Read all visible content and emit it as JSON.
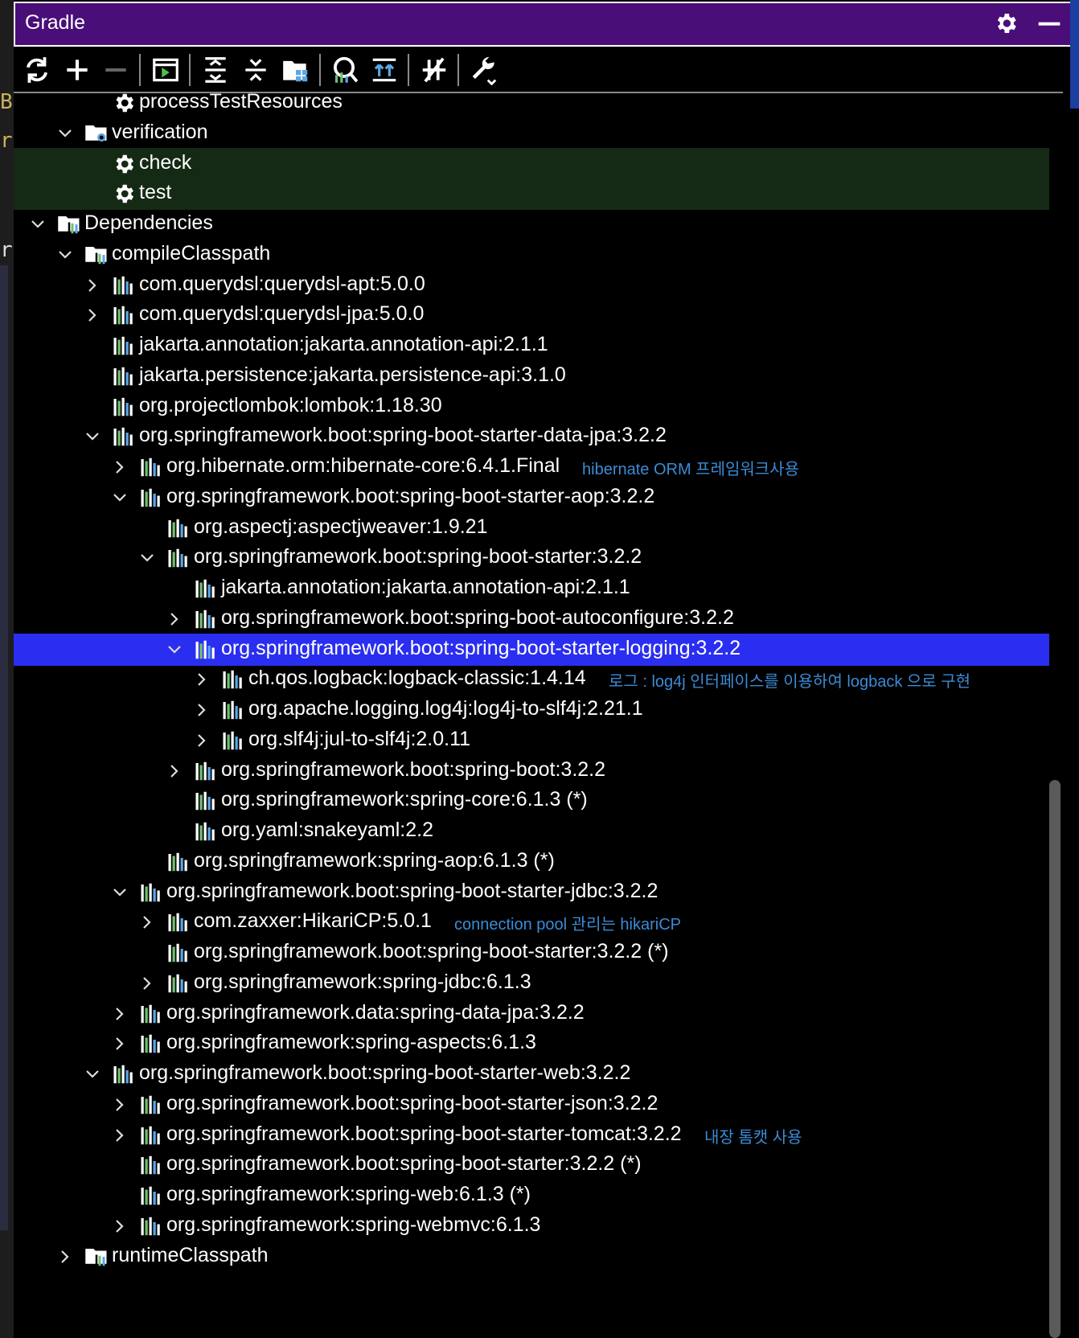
{
  "window": {
    "title": "Gradle"
  },
  "toolbar": {
    "buttons": [
      {
        "name": "reload-all-button",
        "icon": "refresh-icon"
      },
      {
        "name": "add-project-button",
        "icon": "plus-icon"
      },
      {
        "name": "remove-project-button",
        "icon": "minus-icon"
      },
      {
        "name": "execute-task-button",
        "icon": "run-terminal-icon"
      },
      {
        "name": "expand-all-button",
        "icon": "expand-all-icon"
      },
      {
        "name": "collapse-all-button",
        "icon": "collapse-all-icon"
      },
      {
        "name": "group-modules-button",
        "icon": "folder-group-icon"
      },
      {
        "name": "analyze-dependencies-button",
        "icon": "analyze-icon"
      },
      {
        "name": "show-dependencies-button",
        "icon": "dependencies-icon"
      },
      {
        "name": "toggle-offline-button",
        "icon": "offline-icon"
      },
      {
        "name": "build-tool-settings-button",
        "icon": "wrench-icon"
      }
    ]
  },
  "tree": {
    "rows": [
      {
        "label": "processTestResources",
        "icon": "gear",
        "indent": 4,
        "chevron": "none"
      },
      {
        "label": "verification",
        "icon": "folder-gear",
        "indent": 3,
        "chevron": "down"
      },
      {
        "label": "check",
        "icon": "gear",
        "indent": 4,
        "chevron": "none",
        "highlight": "green"
      },
      {
        "label": "test",
        "icon": "gear",
        "indent": 4,
        "chevron": "none",
        "highlight": "green"
      },
      {
        "label": "Dependencies",
        "icon": "folder-lib",
        "indent": 2,
        "chevron": "down"
      },
      {
        "label": "compileClasspath",
        "icon": "folder-lib",
        "indent": 3,
        "chevron": "down"
      },
      {
        "label": "com.querydsl:querydsl-apt:5.0.0",
        "icon": "lib",
        "indent": 4,
        "chevron": "right"
      },
      {
        "label": "com.querydsl:querydsl-jpa:5.0.0",
        "icon": "lib",
        "indent": 4,
        "chevron": "right"
      },
      {
        "label": "jakarta.annotation:jakarta.annotation-api:2.1.1",
        "icon": "lib",
        "indent": 4,
        "chevron": "none"
      },
      {
        "label": "jakarta.persistence:jakarta.persistence-api:3.1.0",
        "icon": "lib",
        "indent": 4,
        "chevron": "none"
      },
      {
        "label": "org.projectlombok:lombok:1.18.30",
        "icon": "lib",
        "indent": 4,
        "chevron": "none"
      },
      {
        "label": "org.springframework.boot:spring-boot-starter-data-jpa:3.2.2",
        "icon": "lib",
        "indent": 4,
        "chevron": "down"
      },
      {
        "label": "org.hibernate.orm:hibernate-core:6.4.1.Final",
        "icon": "lib",
        "indent": 5,
        "chevron": "right",
        "note": "hibernate ORM 프레임워크사용"
      },
      {
        "label": "org.springframework.boot:spring-boot-starter-aop:3.2.2",
        "icon": "lib",
        "indent": 5,
        "chevron": "down"
      },
      {
        "label": "org.aspectj:aspectjweaver:1.9.21",
        "icon": "lib",
        "indent": 6,
        "chevron": "none"
      },
      {
        "label": "org.springframework.boot:spring-boot-starter:3.2.2",
        "icon": "lib",
        "indent": 6,
        "chevron": "down"
      },
      {
        "label": "jakarta.annotation:jakarta.annotation-api:2.1.1",
        "icon": "lib",
        "indent": 7,
        "chevron": "none"
      },
      {
        "label": "org.springframework.boot:spring-boot-autoconfigure:3.2.2",
        "icon": "lib",
        "indent": 7,
        "chevron": "right"
      },
      {
        "label": "org.springframework.boot:spring-boot-starter-logging:3.2.2",
        "icon": "lib",
        "indent": 7,
        "chevron": "down",
        "selected": true
      },
      {
        "label": "ch.qos.logback:logback-classic:1.4.14",
        "icon": "lib",
        "indent": 8,
        "chevron": "right",
        "note": "로그 : log4j 인터페이스를 이용하여 logback 으로 구현"
      },
      {
        "label": "org.apache.logging.log4j:log4j-to-slf4j:2.21.1",
        "icon": "lib",
        "indent": 8,
        "chevron": "right"
      },
      {
        "label": "org.slf4j:jul-to-slf4j:2.0.11",
        "icon": "lib",
        "indent": 8,
        "chevron": "right"
      },
      {
        "label": "org.springframework.boot:spring-boot:3.2.2",
        "icon": "lib",
        "indent": 7,
        "chevron": "right"
      },
      {
        "label": "org.springframework:spring-core:6.1.3 (*)",
        "icon": "lib",
        "indent": 7,
        "chevron": "none"
      },
      {
        "label": "org.yaml:snakeyaml:2.2",
        "icon": "lib",
        "indent": 7,
        "chevron": "none"
      },
      {
        "label": "org.springframework:spring-aop:6.1.3 (*)",
        "icon": "lib",
        "indent": 6,
        "chevron": "none"
      },
      {
        "label": "org.springframework.boot:spring-boot-starter-jdbc:3.2.2",
        "icon": "lib",
        "indent": 5,
        "chevron": "down"
      },
      {
        "label": "com.zaxxer:HikariCP:5.0.1",
        "icon": "lib",
        "indent": 6,
        "chevron": "right",
        "note": "connection pool 관리는 hikariCP"
      },
      {
        "label": "org.springframework.boot:spring-boot-starter:3.2.2 (*)",
        "icon": "lib",
        "indent": 6,
        "chevron": "none"
      },
      {
        "label": "org.springframework:spring-jdbc:6.1.3",
        "icon": "lib",
        "indent": 6,
        "chevron": "right"
      },
      {
        "label": "org.springframework.data:spring-data-jpa:3.2.2",
        "icon": "lib",
        "indent": 5,
        "chevron": "right"
      },
      {
        "label": "org.springframework:spring-aspects:6.1.3",
        "icon": "lib",
        "indent": 5,
        "chevron": "right"
      },
      {
        "label": "org.springframework.boot:spring-boot-starter-web:3.2.2",
        "icon": "lib",
        "indent": 4,
        "chevron": "down"
      },
      {
        "label": "org.springframework.boot:spring-boot-starter-json:3.2.2",
        "icon": "lib",
        "indent": 5,
        "chevron": "right"
      },
      {
        "label": "org.springframework.boot:spring-boot-starter-tomcat:3.2.2",
        "icon": "lib",
        "indent": 5,
        "chevron": "right",
        "note": "내장 톰캣 사용"
      },
      {
        "label": "org.springframework.boot:spring-boot-starter:3.2.2 (*)",
        "icon": "lib",
        "indent": 5,
        "chevron": "none"
      },
      {
        "label": "org.springframework:spring-web:6.1.3 (*)",
        "icon": "lib",
        "indent": 5,
        "chevron": "none"
      },
      {
        "label": "org.springframework:spring-webmvc:6.1.3",
        "icon": "lib",
        "indent": 5,
        "chevron": "right"
      },
      {
        "label": "runtimeClasspath",
        "icon": "folder-lib",
        "indent": 3,
        "chevron": "right"
      }
    ]
  },
  "colors": {
    "title_bar": "#4a0e78",
    "selected_row": "#2a2ef0",
    "highlight_row": "#142a14",
    "annotation_text": "#3b8bd6",
    "lib_icon_green": "#6fc26f",
    "lib_icon_blue": "#5aa8e8"
  }
}
